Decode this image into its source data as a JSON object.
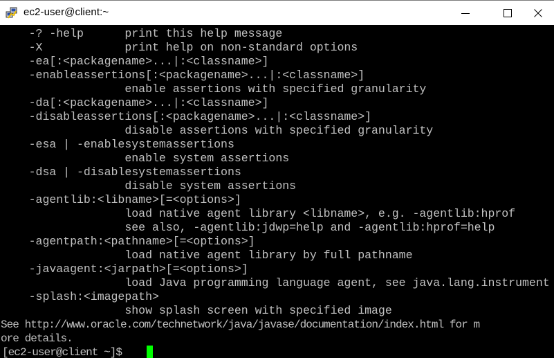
{
  "window": {
    "title": "ec2-user@client:~",
    "controls": {
      "minimize": "—",
      "maximize": "☐",
      "close": "✕"
    }
  },
  "terminal": {
    "lines": [
      "    -? -help      print this help message",
      "    -X            print help on non-standard options",
      "    -ea[:<packagename>...|:<classname>]",
      "    -enableassertions[:<packagename>...|:<classname>]",
      "                  enable assertions with specified granularity",
      "    -da[:<packagename>...|:<classname>]",
      "    -disableassertions[:<packagename>...|:<classname>]",
      "                  disable assertions with specified granularity",
      "    -esa | -enablesystemassertions",
      "                  enable system assertions",
      "    -dsa | -disablesystemassertions",
      "                  disable system assertions",
      "    -agentlib:<libname>[=<options>]",
      "                  load native agent library <libname>, e.g. -agentlib:hprof",
      "                  see also, -agentlib:jdwp=help and -agentlib:hprof=help",
      "    -agentpath:<pathname>[=<options>]",
      "                  load native agent library by full pathname",
      "    -javaagent:<jarpath>[=<options>]",
      "                  load Java programming language agent, see java.lang.instrument",
      "    -splash:<imagepath>",
      "                  show splash screen with specified image"
    ],
    "footer_lines": [
      "See http://www.oracle.com/technetwork/java/javase/documentation/index.html for m",
      "ore details."
    ],
    "prompt": "[ec2-user@client ~]$ ",
    "text_color": "#c0c0c0",
    "cursor_color": "#00ff00",
    "background": "#000000"
  }
}
